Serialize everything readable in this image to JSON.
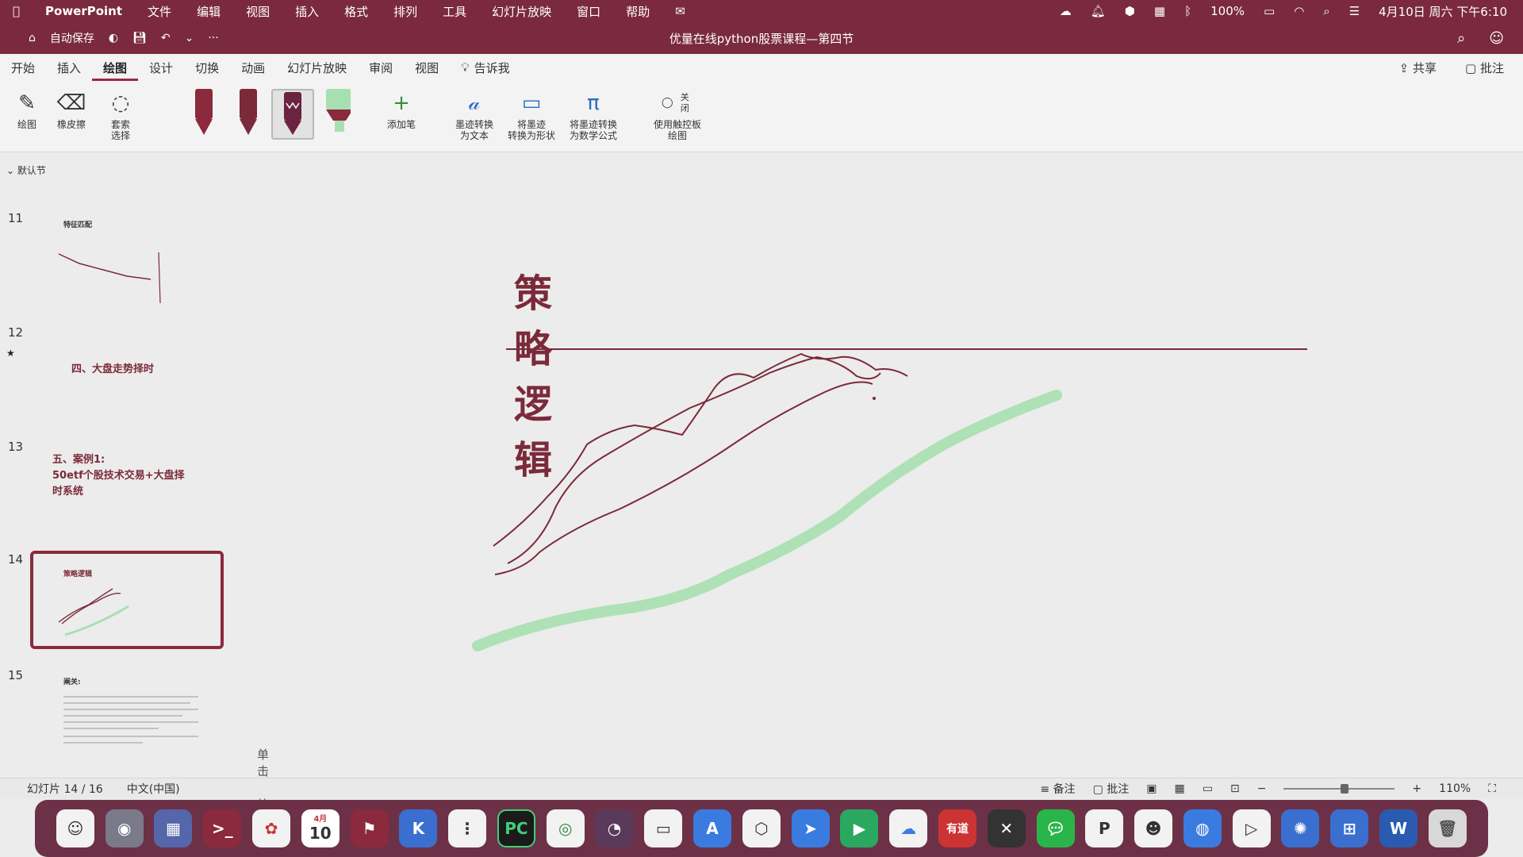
{
  "menubar": {
    "apple": "",
    "app": "PowerPoint",
    "items": [
      "文件",
      "编辑",
      "视图",
      "插入",
      "格式",
      "排列",
      "工具",
      "幻灯片放映",
      "窗口",
      "帮助"
    ],
    "battery": "100%",
    "datetime": "4月10日 周六 下午6:10"
  },
  "titlebar": {
    "autosave": "自动保存",
    "more": "···",
    "doc_title": "优量在线python股票课程—第四节"
  },
  "tabs": {
    "items": [
      "开始",
      "插入",
      "绘图",
      "设计",
      "切换",
      "动画",
      "幻灯片放映",
      "审阅",
      "视图"
    ],
    "active_index": 2,
    "tell_me": "告诉我",
    "share": "共享",
    "comments": "批注"
  },
  "ribbon": {
    "draw": "绘图",
    "eraser": "橡皮擦",
    "lasso": "套索\n选择",
    "add_pen": "添加笔",
    "ink_to_text": "墨迹转换\n为文本",
    "ink_to_shape": "将墨迹\n转换为形状",
    "ink_to_math": "将墨迹转换\n为数学公式",
    "trackpad_toggle": "关闭",
    "trackpad_draw": "使用触控板\n绘图"
  },
  "sidebar": {
    "section": "默认节",
    "slides": [
      {
        "num": "11",
        "title": "特征匹配"
      },
      {
        "num": "12",
        "title": "四、大盘走势择时"
      },
      {
        "num": "13",
        "title": "五、案例1:\n50etf个股技术交易+大盘择\n时系统"
      },
      {
        "num": "14",
        "title": "策略逻辑"
      },
      {
        "num": "15",
        "title": "阐关:"
      }
    ],
    "selected_num": "14"
  },
  "slide": {
    "title": "策略逻辑",
    "notes_placeholder": "单击此处添加备注"
  },
  "statusbar": {
    "slide_position": "幻灯片 14 / 16",
    "language": "中文(中国)",
    "notes": "备注",
    "comments": "批注",
    "zoom": "110%",
    "zoom_level": 0.55
  },
  "dock": {
    "calendar_month": "4月",
    "calendar_day": "10",
    "pycharm": "PC",
    "youdao": "有道",
    "word": "W"
  },
  "colors": {
    "chrome": "#7a2a3c",
    "accent": "#8b2a3c",
    "ink_red": "#7b2a3a",
    "ink_green": "#a7e0b0"
  }
}
